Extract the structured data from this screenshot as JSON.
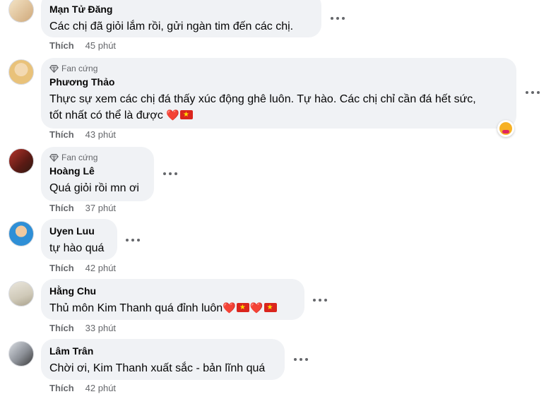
{
  "comments": [
    {
      "author": "Mạn Tử Đăng",
      "badge": "",
      "text": "Các chị đã giỏi lắm rồi, gửi ngàn tim đến các chị.",
      "like_label": "Thích",
      "time": "45 phút"
    },
    {
      "author": "Phương Thảo",
      "badge": "Fan cứng",
      "text_line1": "Thực sự xem các chị đá thấy xúc động ghê luôn. Tự hào. Các chị chỉ cần đá hết sức,",
      "text_line2": "tốt nhất có thể là được",
      "like_label": "Thích",
      "time": "43 phút",
      "reaction": "care-reaction-icon"
    },
    {
      "author": "Hoàng Lê",
      "badge": "Fan cứng",
      "text": "Quá giỏi rồi mn ơi",
      "like_label": "Thích",
      "time": "37 phút"
    },
    {
      "author": "Uyen Luu",
      "badge": "",
      "text": "tự hào quá",
      "like_label": "Thích",
      "time": "42 phút"
    },
    {
      "author": "Hằng Chu",
      "badge": "",
      "text": "Thủ môn Kim Thanh quá đỉnh luôn",
      "like_label": "Thích",
      "time": "33 phút"
    },
    {
      "author": "Lâm Trân",
      "badge": "",
      "text": "Chời ơi, Kim Thanh xuất sắc - bản lĩnh quá",
      "like_label": "Thích",
      "time": "42 phút"
    }
  ],
  "colors": {
    "bubble": "#f0f2f5",
    "meta_text": "#65676b",
    "heart": "#e0245e",
    "flag_red": "#da251d",
    "flag_star": "#ffde00"
  }
}
